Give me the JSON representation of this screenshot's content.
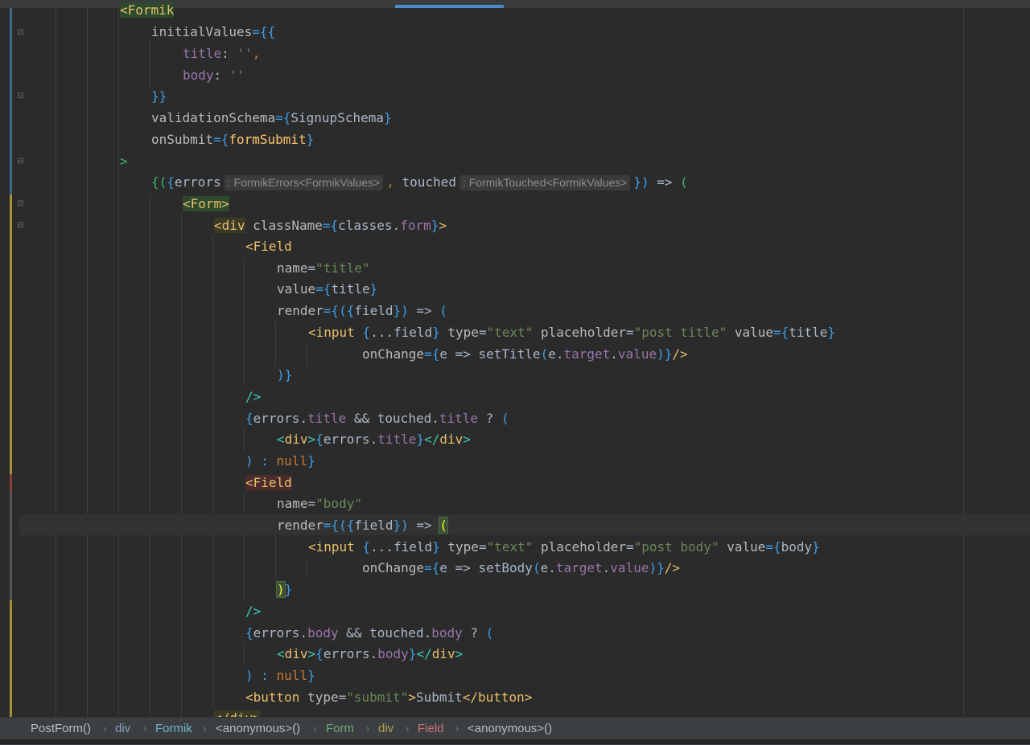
{
  "code": {
    "lines": {
      "l0": "<Formik",
      "l1a": "initialValues",
      "l1b": "={{",
      "l2a": "title",
      "l2b": ": ",
      "l2c": "''",
      "l2d": ",",
      "l3a": "body",
      "l3b": ": ",
      "l3c": "''",
      "l4": "}}",
      "l5a": "validationSchema",
      "l5b": "={",
      "l5c": "SignupSchema",
      "l5d": "}",
      "l6a": "onSubmit",
      "l6b": "={",
      "l6c": "formSubmit",
      "l6d": "}",
      "l7": ">",
      "l8a": "{(",
      "l8b": "{",
      "l8c": "errors",
      "l8h1": ": FormikErrors<FormikValues>",
      "l8d": ", ",
      "l8e": "touched",
      "l8h2": ": FormikTouched<FormikValues>",
      "l8f": "})",
      "l8g": " => ",
      "l8i": "(",
      "l9": "<Form>",
      "l10a": "<",
      "l10b": "div",
      "l10c": " className",
      "l10d": "={",
      "l10e": "classes",
      "l10f": ".",
      "l10g": "form",
      "l10h": "}",
      "l10i": ">",
      "l11a": "<",
      "l11b": "Field",
      "l12a": "name",
      "l12b": "=",
      "l12c": "\"title\"",
      "l13a": "value",
      "l13b": "={",
      "l13c": "title",
      "l13d": "}",
      "l14a": "render",
      "l14b": "={",
      "l14c": "({",
      "l14d": "field",
      "l14e": "})",
      "l14f": " => ",
      "l14g": "(",
      "l15a": "<input",
      "l15b": " {",
      "l15c": "...field",
      "l15d": "}",
      "l15e": " type",
      "l15f": "=",
      "l15g": "\"text\"",
      "l15h": " placeholder",
      "l15i": "=",
      "l15j": "\"post title\"",
      "l15k": " value",
      "l15l": "={",
      "l15m": "title",
      "l15n": "}",
      "l16a": "onChange",
      "l16b": "={",
      "l16c": "e",
      "l16d": " => ",
      "l16e": "setTitle",
      "l16f": "(",
      "l16g": "e",
      "l16h": ".",
      "l16i": "target",
      "l16j": ".",
      "l16k": "value",
      "l16l": ")}",
      "l16m": "/>",
      "l17": ")}",
      "l18": "/>",
      "l19a": "{",
      "l19b": "errors",
      "l19c": ".",
      "l19d": "title",
      "l19e": " && ",
      "l19f": "touched",
      "l19g": ".",
      "l19h": "title",
      "l19i": " ? ",
      "l19j": "(",
      "l20a": "<",
      "l20b": "div",
      "l20c": ">",
      "l20d": "{",
      "l20e": "errors",
      "l20f": ".",
      "l20g": "title",
      "l20h": "}",
      "l20i": "</",
      "l20j": "div",
      "l20k": ">",
      "l21a": ") : ",
      "l21b": "null",
      "l21c": "}",
      "l22a": "<",
      "l22b": "Field",
      "l23a": "name",
      "l23b": "=",
      "l23c": "\"body\"",
      "l24a": "render",
      "l24b": "={",
      "l24c": "({",
      "l24d": "field",
      "l24e": "})",
      "l24f": " => ",
      "l24g": "(",
      "l25a": "<input",
      "l25b": " {",
      "l25c": "...field",
      "l25d": "}",
      "l25e": " type",
      "l25f": "=",
      "l25g": "\"text\"",
      "l25h": " placeholder",
      "l25i": "=",
      "l25j": "\"post body\"",
      "l25k": " value",
      "l25l": "={",
      "l25m": "body",
      "l25n": "}",
      "l26a": "onChange",
      "l26b": "={",
      "l26c": "e",
      "l26d": " => ",
      "l26e": "setBody",
      "l26f": "(",
      "l26g": "e",
      "l26h": ".",
      "l26i": "target",
      "l26j": ".",
      "l26k": "value",
      "l26l": ")}",
      "l26m": "/>",
      "l27a": ")",
      "l27b": "}",
      "l28": "/>",
      "l29a": "{",
      "l29b": "errors",
      "l29c": ".",
      "l29d": "body",
      "l29e": " && ",
      "l29f": "touched",
      "l29g": ".",
      "l29h": "body",
      "l29i": " ? ",
      "l29j": "(",
      "l30a": "<",
      "l30b": "div",
      "l30c": ">",
      "l30d": "{",
      "l30e": "errors",
      "l30f": ".",
      "l30g": "body",
      "l30h": "}",
      "l30i": "</",
      "l30j": "div",
      "l30k": ">",
      "l31a": ") : ",
      "l31b": "null",
      "l31c": "}",
      "l32a": "<",
      "l32b": "button",
      "l32c": " type",
      "l32d": "=",
      "l32e": "\"submit\"",
      "l32f": ">",
      "l32g": "Submit",
      "l32h": "</",
      "l32i": "button",
      "l32j": ">",
      "l33": "</div>"
    }
  },
  "breadcrumbs": [
    "PostForm()",
    "div",
    "Formik",
    "<anonymous>()",
    "Form",
    "div",
    "Field",
    "<anonymous>()"
  ],
  "breadcrumb_separator": "›",
  "colors": {
    "background": "#2b2b2b",
    "tag": "#e8bf6a",
    "string": "#6a8759",
    "keyword": "#cc7832",
    "property": "#9876aa",
    "brace": "#3d9ee8",
    "accent_tab": "#4a88c7"
  }
}
